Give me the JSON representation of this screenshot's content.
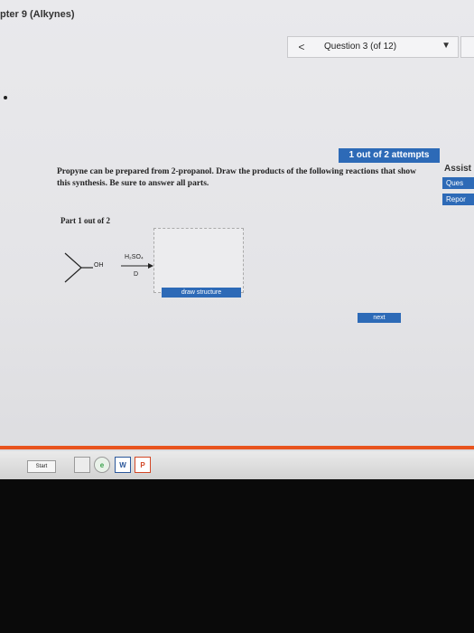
{
  "window": {
    "chapter_title": "pter 9 (Alkynes)"
  },
  "question_nav": {
    "prev_icon": "chevron-left-icon",
    "prev_symbol": "<",
    "label": "Question 3 (of 12)",
    "dropdown_symbol": "▼"
  },
  "attempts": {
    "label": "1 out of 2 attempts"
  },
  "question": {
    "text": "Propyne can be prepared from 2-propanol. Draw the products of the following reactions that show this synthesis. Be sure to answer all parts."
  },
  "sidebar": {
    "heading": "Assist",
    "buttons": [
      {
        "label": "Ques"
      },
      {
        "label": "Repor"
      }
    ]
  },
  "part": {
    "label": "Part 1 out of 2"
  },
  "reaction": {
    "substituent": "OH",
    "reagent_top": "H₂SO₄",
    "reagent_bottom": "D"
  },
  "draw_structure_label": "draw structure",
  "next_label": "next",
  "taskbar": {
    "start_label": "Start",
    "word_label": "W",
    "ppt_label": "P"
  },
  "colors": {
    "accent": "#2d6ab7",
    "divider": "#e8531d"
  }
}
